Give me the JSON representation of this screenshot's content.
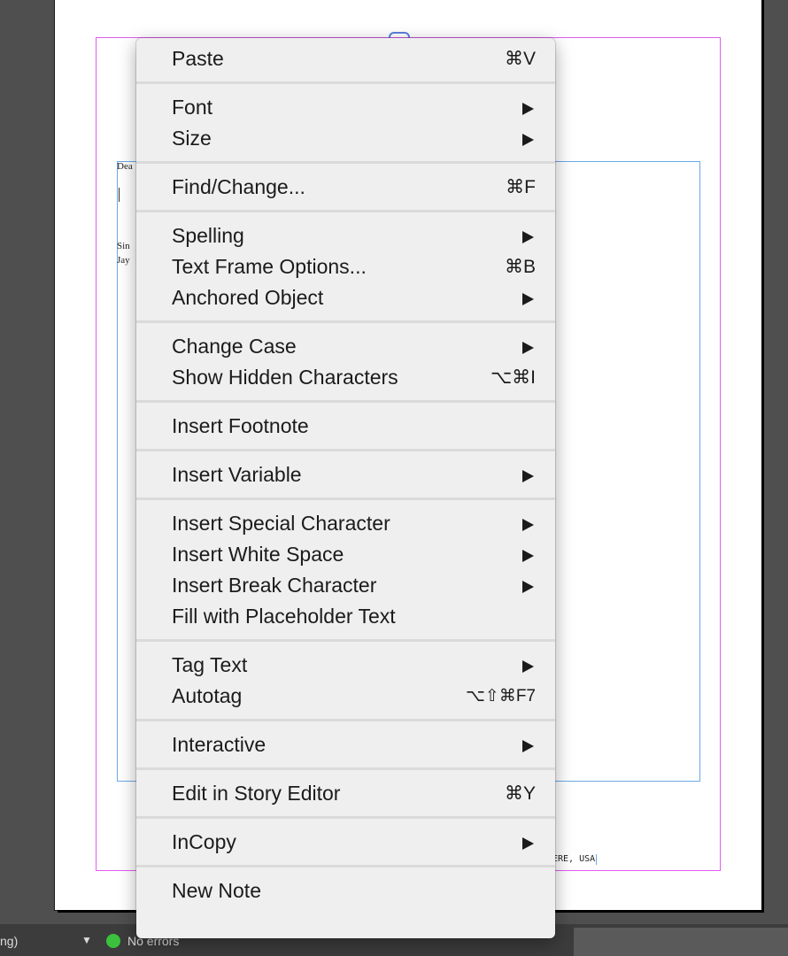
{
  "document": {
    "letter_lines": [
      "Dea",
      "Sin",
      "Jay"
    ],
    "footer_text": "ERE, USA"
  },
  "status_bar": {
    "left_text": "ng)",
    "errors_text": "No errors",
    "ok_color": "#3cc13c"
  },
  "context_menu": {
    "groups": [
      [
        {
          "label": "Paste",
          "shortcut": "⌘V",
          "submenu": false
        }
      ],
      [
        {
          "label": "Font",
          "shortcut": "",
          "submenu": true
        },
        {
          "label": "Size",
          "shortcut": "",
          "submenu": true
        }
      ],
      [
        {
          "label": "Find/Change...",
          "shortcut": "⌘F",
          "submenu": false
        }
      ],
      [
        {
          "label": "Spelling",
          "shortcut": "",
          "submenu": true
        },
        {
          "label": "Text Frame Options...",
          "shortcut": "⌘B",
          "submenu": false
        },
        {
          "label": "Anchored Object",
          "shortcut": "",
          "submenu": true
        }
      ],
      [
        {
          "label": "Change Case",
          "shortcut": "",
          "submenu": true
        },
        {
          "label": "Show Hidden Characters",
          "shortcut": "⌥⌘I",
          "submenu": false
        }
      ],
      [
        {
          "label": "Insert Footnote",
          "shortcut": "",
          "submenu": false
        }
      ],
      [
        {
          "label": "Insert Variable",
          "shortcut": "",
          "submenu": true
        }
      ],
      [
        {
          "label": "Insert Special Character",
          "shortcut": "",
          "submenu": true
        },
        {
          "label": "Insert White Space",
          "shortcut": "",
          "submenu": true
        },
        {
          "label": "Insert Break Character",
          "shortcut": "",
          "submenu": true
        },
        {
          "label": "Fill with Placeholder Text",
          "shortcut": "",
          "submenu": false
        }
      ],
      [
        {
          "label": "Tag Text",
          "shortcut": "",
          "submenu": true
        },
        {
          "label": "Autotag",
          "shortcut": "⌥⇧⌘F7",
          "submenu": false
        }
      ],
      [
        {
          "label": "Interactive",
          "shortcut": "",
          "submenu": true
        }
      ],
      [
        {
          "label": "Edit in Story Editor",
          "shortcut": "⌘Y",
          "submenu": false
        }
      ],
      [
        {
          "label": "InCopy",
          "shortcut": "",
          "submenu": true
        }
      ],
      [
        {
          "label": "New Note",
          "shortcut": "",
          "submenu": false
        }
      ]
    ]
  }
}
